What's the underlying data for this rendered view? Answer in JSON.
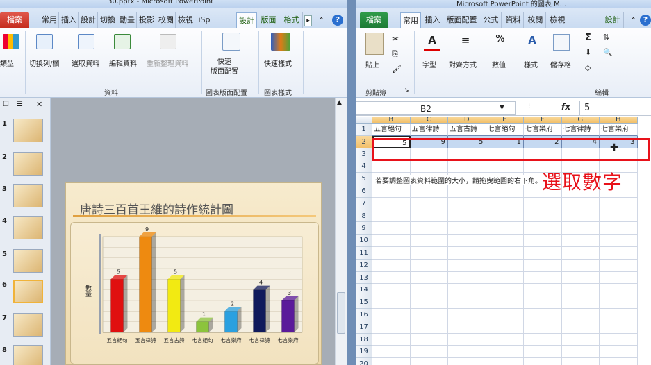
{
  "ppt": {
    "title": "30.pptx - Microsoft PowerPoint",
    "file_tab": "檔案",
    "tabs": [
      "常用",
      "插入",
      "設計",
      "切換",
      "動畫",
      "投影",
      "校閱",
      "檢視",
      "iSp",
      "設計",
      "版面",
      "格式"
    ],
    "commands": {
      "chart_type": "類型",
      "switch_row_col": "切換列/欄",
      "select_data": "選取資料",
      "edit_data": "編輯資料",
      "refresh_data": "重新整理資料",
      "quick_layout": "快速\n版面配置",
      "quick_style": "快速樣式"
    },
    "groups": {
      "data": "資料",
      "layout": "圖表版面配置",
      "styles": "圖表樣式"
    },
    "slides": [
      "1",
      "2",
      "3",
      "4",
      "5",
      "6",
      "7",
      "8"
    ],
    "selected_slide": "6",
    "slide_title": "唐詩三百首王維的詩作統計圖"
  },
  "excel": {
    "title": "Microsoft PowerPoint 的圖表 M...",
    "file_tab": "檔案",
    "tabs": [
      "常用",
      "插入",
      "版面配置",
      "公式",
      "資料",
      "校閱",
      "檢視",
      "設計"
    ],
    "commands": {
      "paste": "貼上",
      "font": "字型",
      "alignment": "對齊方式",
      "number": "數值",
      "styles": "樣式",
      "cells": "儲存格"
    },
    "groups": {
      "clipboard": "剪貼簿",
      "editing": "編輯"
    },
    "name_box": "B2",
    "fx": "fx",
    "formula": "5",
    "columns": [
      "B",
      "C",
      "D",
      "E",
      "F",
      "G",
      "H"
    ],
    "rows": [
      "1",
      "2",
      "3",
      "4",
      "5",
      "6",
      "7",
      "8",
      "9",
      "10",
      "11",
      "12",
      "13",
      "14",
      "15",
      "16",
      "17",
      "18",
      "19",
      "20"
    ],
    "header_row": [
      "五言絕句",
      "五言律詩",
      "五言古詩",
      "七言絕句",
      "七言樂府",
      "七言律詩",
      "七言樂府"
    ],
    "data_row": [
      "5",
      "9",
      "5",
      "1",
      "2",
      "4",
      "3"
    ],
    "note_row5": "若要調整圖表資料範圍的大小，請拖曳範圍的右下角。",
    "annotation": "選取數字"
  },
  "chart_data": {
    "type": "bar",
    "categories": [
      "五言絕句",
      "五言律詩",
      "五言古詩",
      "七言絕句",
      "七言樂府",
      "七言律詩",
      "七言樂府"
    ],
    "values": [
      5,
      9,
      5,
      1,
      2,
      4,
      3
    ],
    "colors": [
      "#e01010",
      "#ee8a10",
      "#f2ea12",
      "#8cc43c",
      "#2aa0e0",
      "#101a5c",
      "#5a1a9a"
    ],
    "ylabel": "數量",
    "ylim": [
      0,
      9
    ]
  }
}
